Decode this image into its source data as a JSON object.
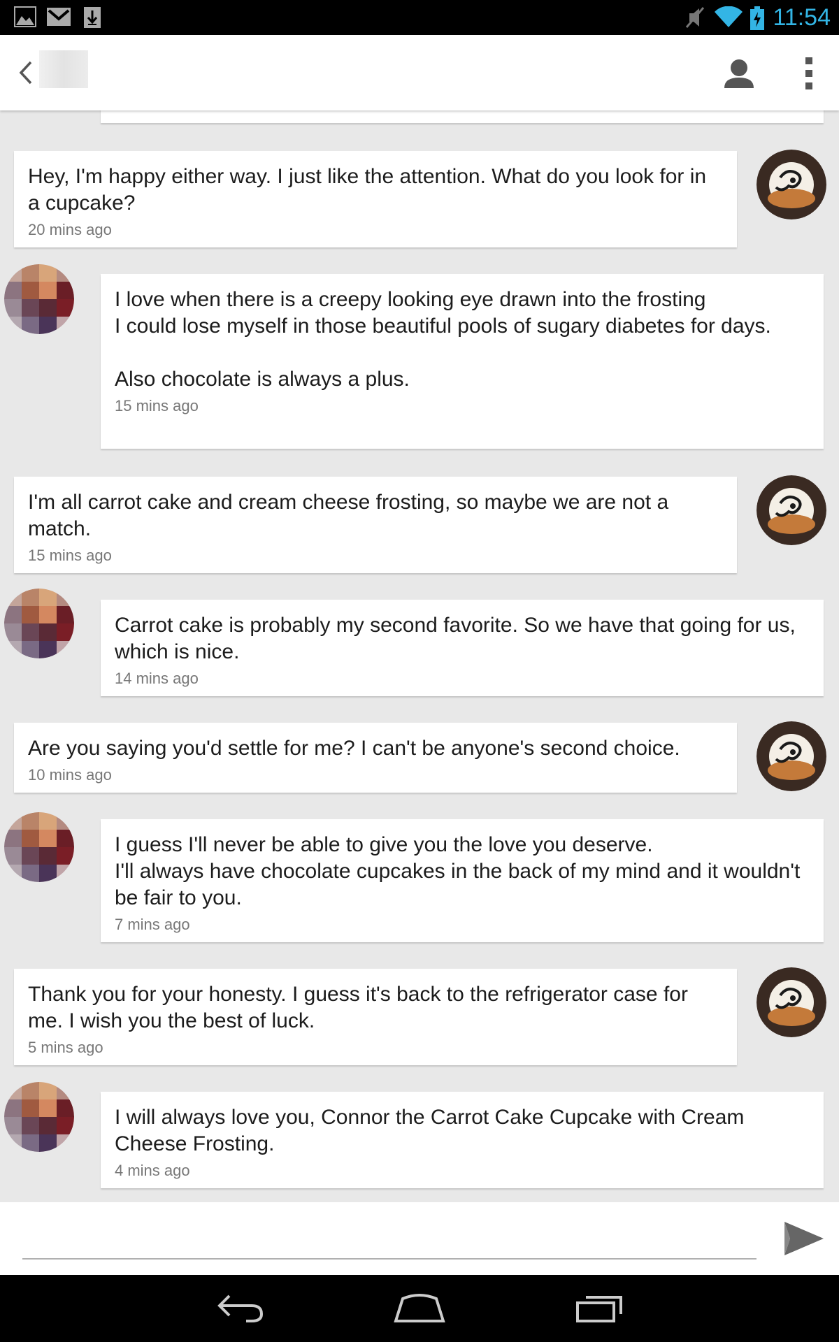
{
  "status_bar": {
    "time": "11:54",
    "icons": [
      "image-icon",
      "gmail-icon",
      "download-icon",
      "mute-icon",
      "wifi-icon",
      "battery-charging-icon"
    ]
  },
  "action_bar": {
    "back_icon": "chevron-left-icon",
    "contact_icon": "person-icon",
    "overflow_icon": "overflow-menu-icon"
  },
  "messages": [
    {
      "dir": "out",
      "text": "Hey, I'm happy either way. I just like the attention. What do you look for in a cupcake?",
      "time": "20 mins ago"
    },
    {
      "dir": "in",
      "text": "I love when there is a creepy looking eye drawn into the frosting\nI could lose myself in those beautiful pools of sugary diabetes for days.\n\nAlso chocolate is always a plus.",
      "time": "15 mins ago"
    },
    {
      "dir": "out",
      "text": "I'm all carrot cake and cream cheese frosting, so maybe we are not a match.",
      "time": "15 mins ago"
    },
    {
      "dir": "in",
      "text": "Carrot cake is probably my second favorite.  So we have that going for us, which is nice.",
      "time": "14 mins ago"
    },
    {
      "dir": "out",
      "text": "Are you saying you'd settle for me? I can't be anyone's second choice.",
      "time": "10 mins ago"
    },
    {
      "dir": "in",
      "text": "I guess I'll never be able to give you the love you deserve.\nI'll always have chocolate cupcakes in the back of my mind and it wouldn't be fair to you.",
      "time": "7 mins ago"
    },
    {
      "dir": "out",
      "text": "Thank you for your honesty. I guess it's back to the refrigerator case for me. I wish you the best of luck.",
      "time": "5 mins ago"
    },
    {
      "dir": "in",
      "text": "I will always love you, Connor the Carrot Cake Cupcake with Cream Cheese Frosting.",
      "time": "4 mins ago"
    }
  ],
  "composer": {
    "placeholder": "",
    "send_icon": "send-icon"
  },
  "nav_bar": {
    "icons": [
      "back-nav-icon",
      "home-nav-icon",
      "recents-nav-icon"
    ]
  },
  "colors": {
    "status_accent": "#33b5e5",
    "background": "#e8e8e8",
    "bubble": "#ffffff",
    "timestamp": "#777777"
  }
}
